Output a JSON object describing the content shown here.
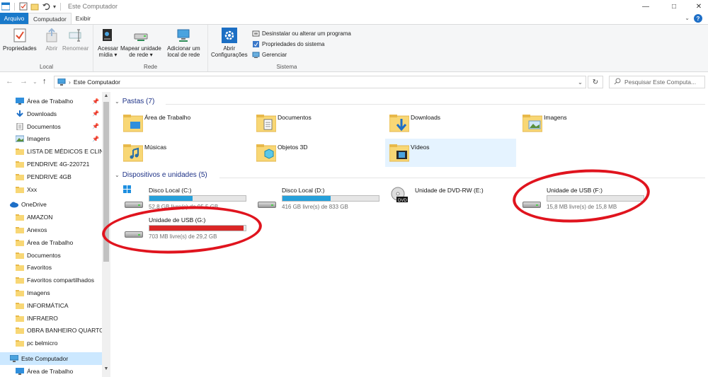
{
  "window": {
    "title": "Este Computador",
    "controls": {
      "minimize": "—",
      "maximize": "□",
      "close": "✕"
    }
  },
  "ribbon_tabs": [
    "Arquivo",
    "Computador",
    "Exibir"
  ],
  "help_label": "?",
  "ribbon": {
    "local": {
      "label": "Local",
      "buttons": [
        "Propriedades",
        "Abrir",
        "Renomear"
      ]
    },
    "rede": {
      "label": "Rede",
      "buttons": [
        {
          "line1": "Acessar",
          "line2": "mídia ▾"
        },
        {
          "line1": "Mapear unidade",
          "line2": "de rede ▾"
        },
        {
          "line1": "Adicionar um",
          "line2": "local de rede"
        }
      ]
    },
    "sistema": {
      "label": "Sistema",
      "big_button": {
        "line1": "Abrir",
        "line2": "Configurações"
      },
      "small_buttons": [
        "Desinstalar ou alterar um programa",
        "Propriedades do sistema",
        "Gerenciar"
      ]
    }
  },
  "address": {
    "path": "Este Computador",
    "search_placeholder": "Pesquisar Este Computa..."
  },
  "nav": {
    "quick_access": [
      {
        "label": "Área de Trabalho",
        "pinned": true,
        "icon": "desktop-icon"
      },
      {
        "label": "Downloads",
        "pinned": true,
        "icon": "download-icon"
      },
      {
        "label": "Documentos",
        "pinned": true,
        "icon": "documents-icon"
      },
      {
        "label": "Imagens",
        "pinned": true,
        "icon": "pictures-icon"
      },
      {
        "label": "LISTA DE MÉDICOS E CLINIC",
        "pinned": false,
        "icon": "folder-icon"
      },
      {
        "label": "PENDRIVE 4G-220721",
        "pinned": false,
        "icon": "folder-icon"
      },
      {
        "label": "PENDRIVE 4GB",
        "pinned": false,
        "icon": "folder-icon"
      },
      {
        "label": "Xxx",
        "pinned": false,
        "icon": "folder-icon"
      }
    ],
    "onedrive_label": "OneDrive",
    "onedrive_items": [
      "AMAZON",
      "Anexos",
      "Área de Trabalho",
      "Documentos",
      "Favoritos",
      "Favoritos compartilhados",
      "Imagens",
      "INFORMÁTICA",
      "INFRAERO",
      "OBRA BANHEIRO QUARTO",
      "pc belmicro"
    ],
    "this_pc_label": "Este Computador",
    "this_pc_child": "Área de Trabalho",
    "pin_glyph": "📌"
  },
  "folders_header": "Pastas (7)",
  "folders": [
    {
      "name": "Área de Trabalho",
      "icon": "desktop-folder-icon"
    },
    {
      "name": "Documentos",
      "icon": "documents-folder-icon"
    },
    {
      "name": "Downloads",
      "icon": "downloads-folder-icon"
    },
    {
      "name": "Imagens",
      "icon": "pictures-folder-icon"
    },
    {
      "name": "Músicas",
      "icon": "music-folder-icon"
    },
    {
      "name": "Objetos 3D",
      "icon": "3d-objects-folder-icon"
    },
    {
      "name": "Vídeos",
      "icon": "videos-folder-icon"
    }
  ],
  "devices_header": "Dispositivos e unidades (5)",
  "drives": [
    {
      "name": "Disco Local (C:)",
      "free": "52,8 GB livre(s) de 95,5 GB",
      "used_fraction": 0.45,
      "icon": "windows-drive-icon",
      "kind": "hdd"
    },
    {
      "name": "Disco Local (D:)",
      "free": "416 GB livre(s) de 833 GB",
      "used_fraction": 0.5,
      "icon": "hdd-icon",
      "kind": "hdd"
    },
    {
      "name": "Unidade de DVD-RW (E:)",
      "free": "",
      "used_fraction": null,
      "icon": "dvd-drive-icon",
      "kind": "dvd"
    },
    {
      "name": "Unidade de USB (F:)",
      "free": "15,8 MB livre(s) de 15,8 MB",
      "used_fraction": 0.0,
      "icon": "usb-drive-icon",
      "kind": "usb"
    },
    {
      "name": "Unidade de USB (G:)",
      "free": "703 MB livre(s) de 29,2 GB",
      "used_fraction": 0.976,
      "icon": "usb-drive-icon",
      "kind": "usb"
    }
  ],
  "colors": {
    "accent": "#1979ca",
    "bar_normal": "#26a0da",
    "bar_full": "#da2626",
    "annotation": "#e0141e",
    "section_header": "#1e3287"
  }
}
